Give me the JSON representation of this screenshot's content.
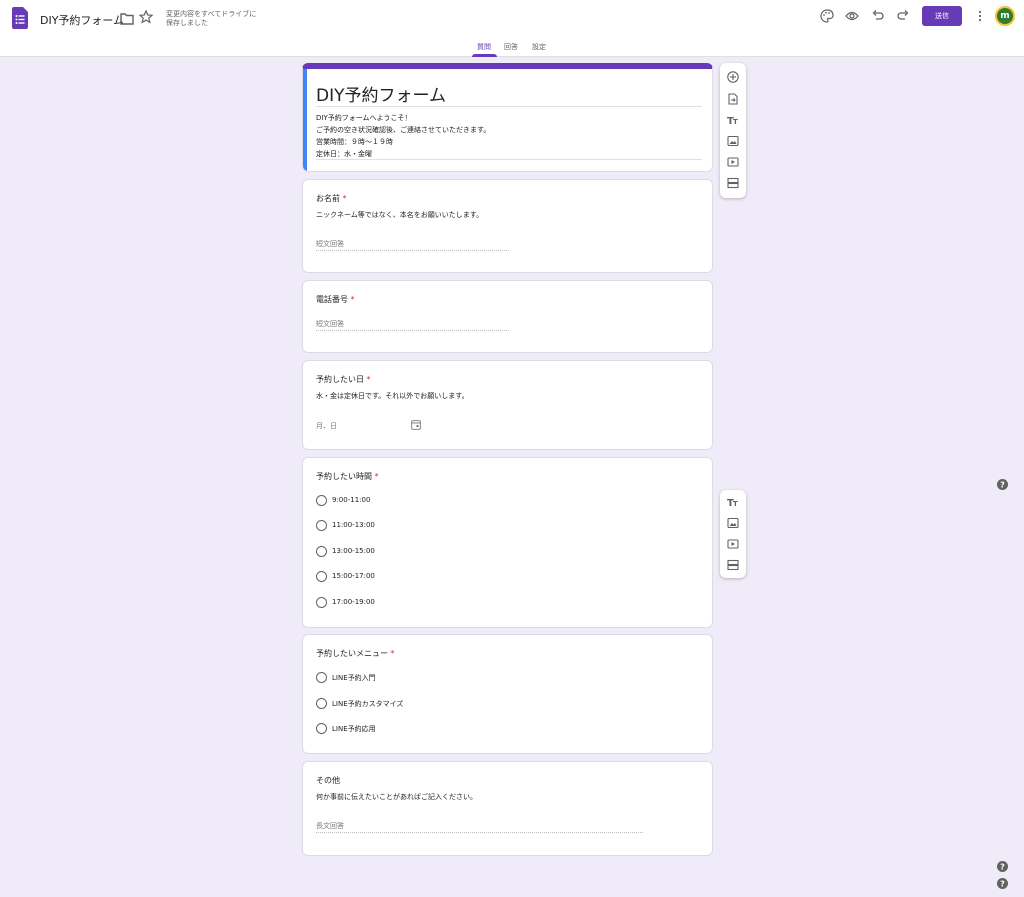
{
  "header": {
    "doc_title": "DIY予約フォーム",
    "save_status_line1": "変更内容をすべてドライブに",
    "save_status_line2": "保存しました",
    "send_label": "送信",
    "avatar_letter": "m"
  },
  "tabs": [
    {
      "label": "質問",
      "active": true
    },
    {
      "label": "回答",
      "active": false
    },
    {
      "label": "設定",
      "active": false
    }
  ],
  "form": {
    "title": "DIY予約フォーム",
    "description": [
      "DIY予約フォームへようこそ！",
      "ご予約の空き状況確認後、ご連絡させていただきます。",
      "営業時間：９時～１９時",
      "定休日：水・金曜"
    ]
  },
  "questions": {
    "name": {
      "title": "お名前",
      "required": "*",
      "description": "ニックネーム等ではなく、本名をお願いいたします。",
      "placeholder": "短文回答"
    },
    "phone": {
      "title": "電話番号",
      "required": "*",
      "placeholder": "短文回答"
    },
    "date": {
      "title": "予約したい日",
      "required": "*",
      "description": "水・金は定休日です。それ以外でお願いします。",
      "placeholder": "月、日"
    },
    "time": {
      "title": "予約したい時間",
      "required": "*",
      "options": [
        "9:00-11:00",
        "11:00-13:00",
        "13:00-15:00",
        "15:00-17:00",
        "17:00-19:00"
      ]
    },
    "menu": {
      "title": "予約したいメニュー",
      "required": "*",
      "options": [
        "LINE予約入門",
        "LINE予約カスタマイズ",
        "LINE予約応用"
      ]
    },
    "other": {
      "title": "その他",
      "description": "何か事前に伝えたいことがあればご記入ください。",
      "placeholder": "長文回答"
    }
  },
  "colors": {
    "accent": "#673ab7",
    "background": "#f0ebf8",
    "focus_bar": "#4285f4",
    "required": "#d93025"
  }
}
